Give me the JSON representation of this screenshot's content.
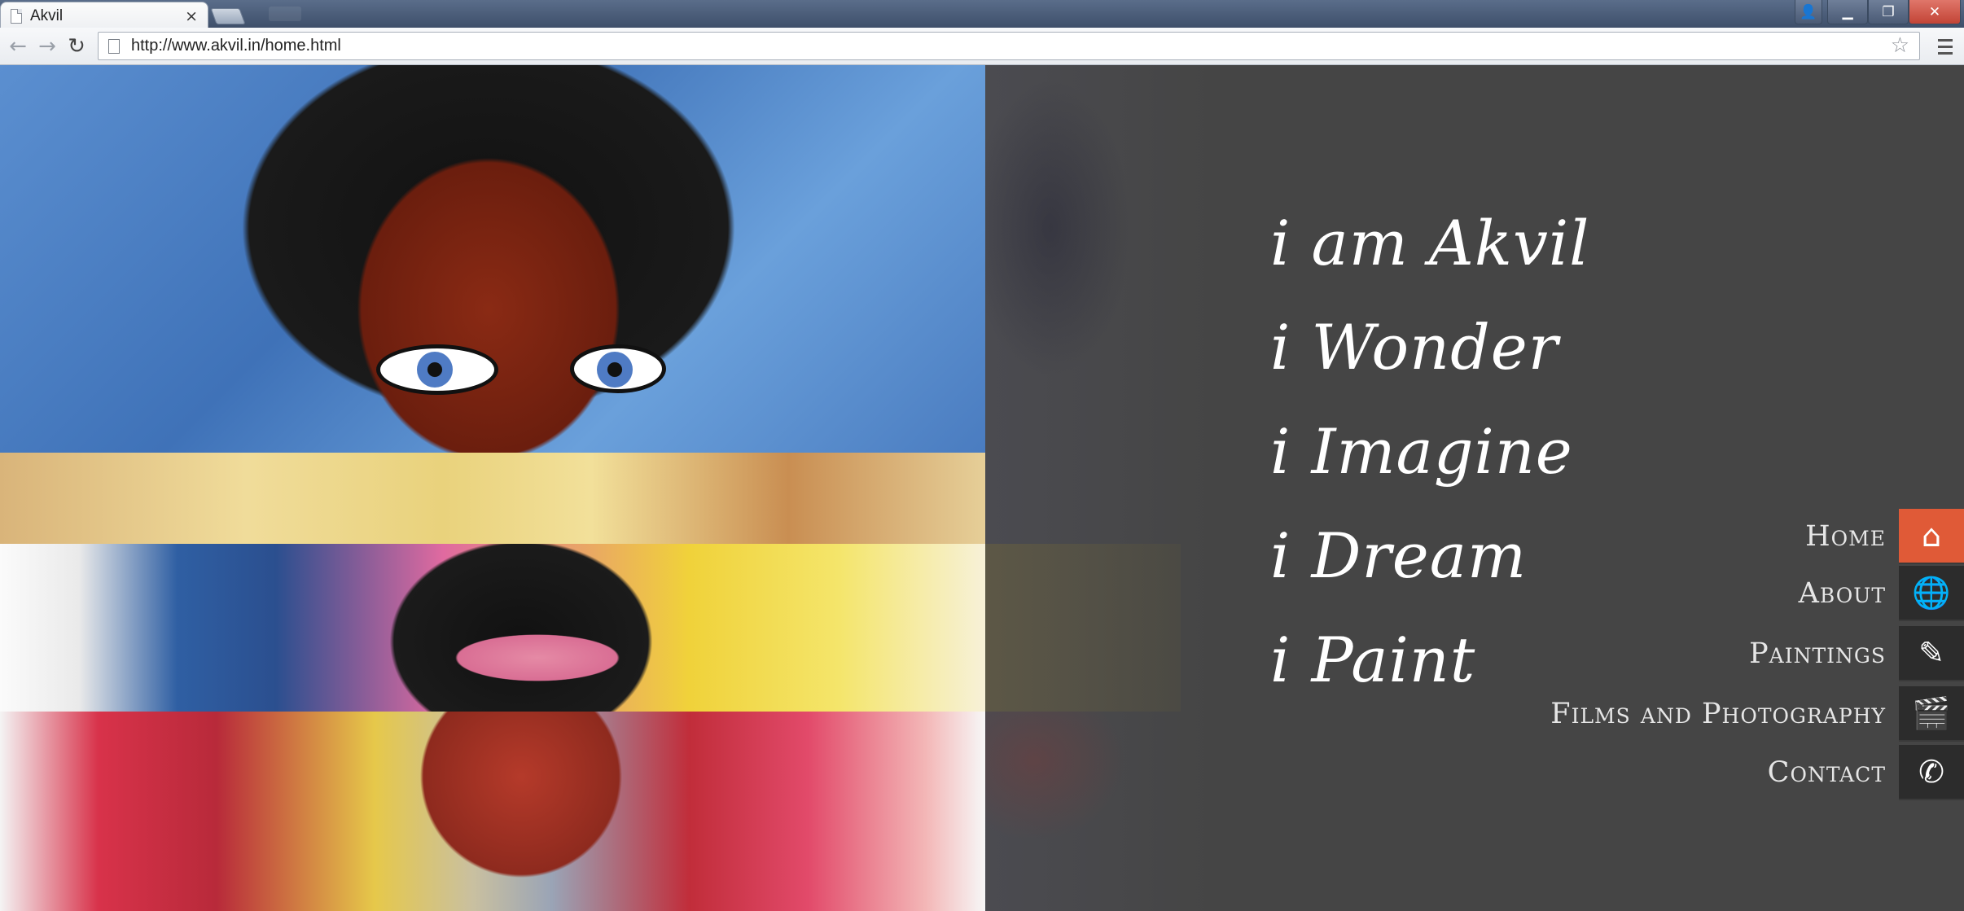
{
  "browser": {
    "tab_title": "Akvil",
    "tab_close": "×",
    "url": "http://www.akvil.in/home.html",
    "window_buttons": {
      "user": "👤",
      "minimize": "▁",
      "maximize": "❐",
      "close": "✕"
    },
    "nav": {
      "back": "←",
      "forward": "→",
      "reload": "↻",
      "bookmark": "☆"
    }
  },
  "hero": {
    "tagline": [
      "i am Akvil",
      "i Wonder",
      "i Imagine",
      "i Dream",
      "i Paint"
    ]
  },
  "nav_menu": {
    "items": [
      {
        "label": "Home",
        "icon": "home-icon",
        "glyph": "⌂",
        "active": true
      },
      {
        "label": "About",
        "icon": "globe-icon",
        "glyph": "🌐",
        "active": false
      },
      {
        "label": "Paintings",
        "icon": "brush-icon",
        "glyph": "✎",
        "active": false
      },
      {
        "label": "Films and Photography",
        "icon": "clapperboard-icon",
        "glyph": "🎬",
        "active": false
      },
      {
        "label": "Contact",
        "icon": "phone-icon",
        "glyph": "✆",
        "active": false
      }
    ],
    "active_color": "#e05a37"
  },
  "colors": {
    "page_bg": "#454545",
    "accent": "#e05a37"
  }
}
